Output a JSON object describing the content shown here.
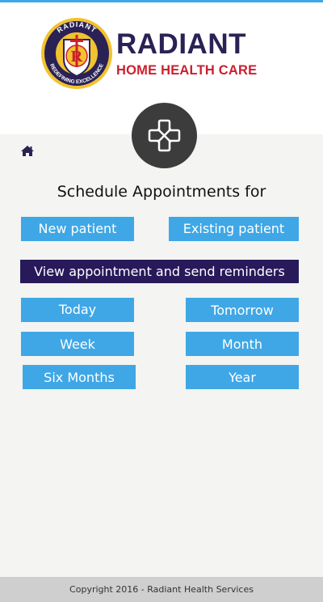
{
  "brand": {
    "name": "RADIANT",
    "subtitle": "HOME HEALTH CARE",
    "emblem_top_text": "RADIANT",
    "emblem_bottom_text": "REDEFINING EXCELLENCE",
    "emblem_letter": "R",
    "colors": {
      "navy": "#2a2255",
      "red": "#cc1f2e",
      "gold": "#f2c230"
    }
  },
  "hub_icon": "hospital-cross-icon",
  "home_icon": "home-icon",
  "page": {
    "title": "Schedule Appointments for"
  },
  "patient_buttons": {
    "new": "New patient",
    "existing": "Existing patient"
  },
  "view_button": "View appointment and send reminders",
  "filters": {
    "today": "Today",
    "tomorrow": "Tomorrow",
    "week": "Week",
    "month": "Month",
    "six_months": "Six Months",
    "year": "Year"
  },
  "footer": {
    "copyright": "Copyright 2016 - Radiant Health Services"
  },
  "colors": {
    "accent": "#3fa7e6",
    "dark_button": "#28195a",
    "footer_bg": "#cfcfcf"
  }
}
